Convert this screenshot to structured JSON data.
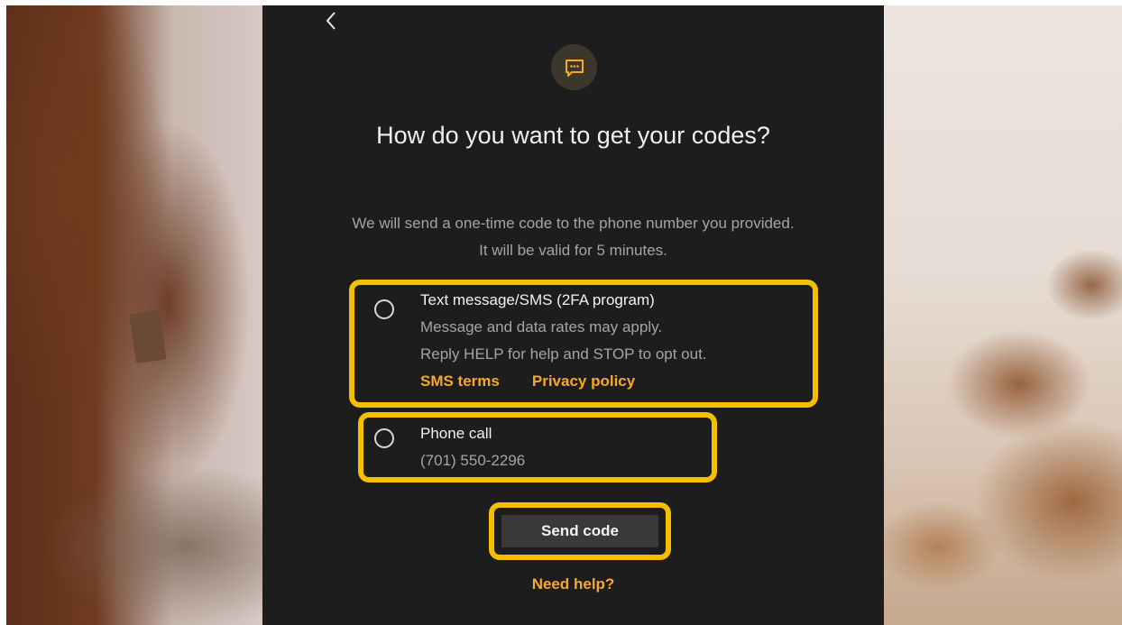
{
  "nav": {
    "back_icon": "chevron-left-icon"
  },
  "header": {
    "icon": "chat-bubble-icon",
    "accent_color": "#f7a82a",
    "title": "How do you want to get your codes?",
    "description_line1": "We will send a one-time code to the phone number you provided.",
    "description_line2": "It will be valid for 5 minutes."
  },
  "options": {
    "sms": {
      "label": "Text message/SMS (2FA program)",
      "line1": "Message and data rates may apply.",
      "line2": "Reply HELP for help and STOP to opt out.",
      "sms_terms": "SMS terms",
      "privacy_policy": "Privacy policy",
      "selected": false
    },
    "phone": {
      "label": "Phone call",
      "number": "(701) 550-2296",
      "selected": false
    }
  },
  "actions": {
    "send_code": "Send code",
    "need_help": "Need help?"
  },
  "highlight_color": "#f5bf00"
}
